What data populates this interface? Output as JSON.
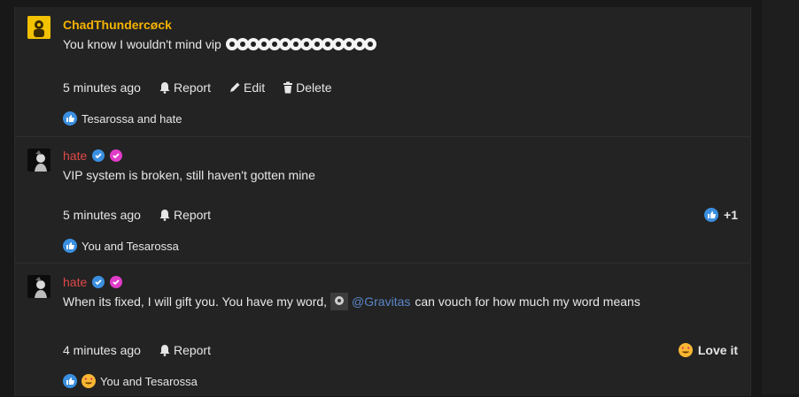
{
  "comments": [
    {
      "author": "ChadThundercøck",
      "author_color": "#f5b301",
      "text": "You know I wouldn't mind vip",
      "eye_emoji_count": 14,
      "time": "5 minutes ago",
      "actions": [
        "Report",
        "Edit",
        "Delete"
      ],
      "reactions_text": "Tesarossa and hate"
    },
    {
      "author": "hate",
      "author_color": "#e04848",
      "text": "VIP system is broken, still haven't gotten mine",
      "time": "5 minutes ago",
      "actions": [
        "Report"
      ],
      "reaction_count": "+1",
      "reactions_text": "You and Tesarossa"
    },
    {
      "author": "hate",
      "author_color": "#e04848",
      "text_before": "When its fixed, I will gift you. You have my word,",
      "mention": "@Gravitas",
      "text_after": "can vouch for how much my word means",
      "time": "4 minutes ago",
      "actions": [
        "Report"
      ],
      "reaction_label": "Love it",
      "reactions_text": "You and Tesarossa"
    }
  ],
  "colors": {
    "like": "#3b8fe0",
    "love": "#f7b733",
    "verified": "#3b8fe0",
    "pink_badge": "#e03cc8",
    "mention": "#5a86c8"
  },
  "icons": [
    "bell-icon",
    "pencil-icon",
    "trash-icon",
    "like-icon",
    "love-eyes-icon",
    "verified-badge-icon"
  ]
}
